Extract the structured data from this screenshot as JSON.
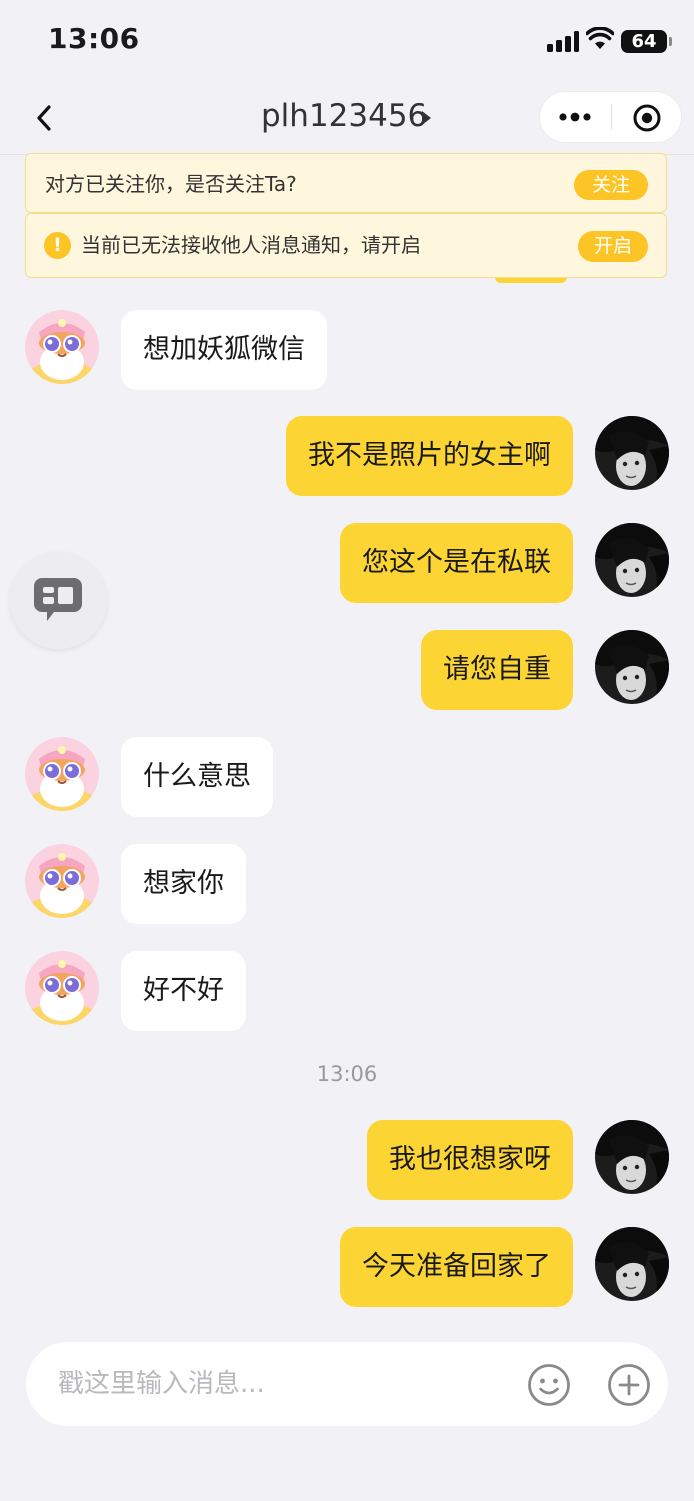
{
  "status_bar": {
    "time": "13:06",
    "battery": "64"
  },
  "nav": {
    "title": "plh123456"
  },
  "banners": {
    "follow": {
      "text": "对方已关注你，是否关注Ta?",
      "button": "关注"
    },
    "notify": {
      "text": "当前已无法接收他人消息通知，请开启",
      "button": "开启"
    }
  },
  "messages": [
    {
      "sender": "other",
      "text": "想加妖狐微信"
    },
    {
      "sender": "self",
      "text": "我不是照片的女主啊"
    },
    {
      "sender": "self",
      "text": "您这个是在私联"
    },
    {
      "sender": "self",
      "text": "请您自重"
    },
    {
      "sender": "other",
      "text": "什么意思"
    },
    {
      "sender": "other",
      "text": "想家你"
    },
    {
      "sender": "other",
      "text": "好不好"
    },
    {
      "sender": "self",
      "text": "我也很想家呀"
    },
    {
      "sender": "self",
      "text": "今天准备回家了"
    }
  ],
  "time_divider": "13:06",
  "input": {
    "placeholder": "戳这里输入消息..."
  },
  "colors": {
    "self_bubble": "#fcd535",
    "accent_button": "#fcc425",
    "banner_bg": "#fff7dd",
    "page_bg": "#f2f2f6"
  }
}
